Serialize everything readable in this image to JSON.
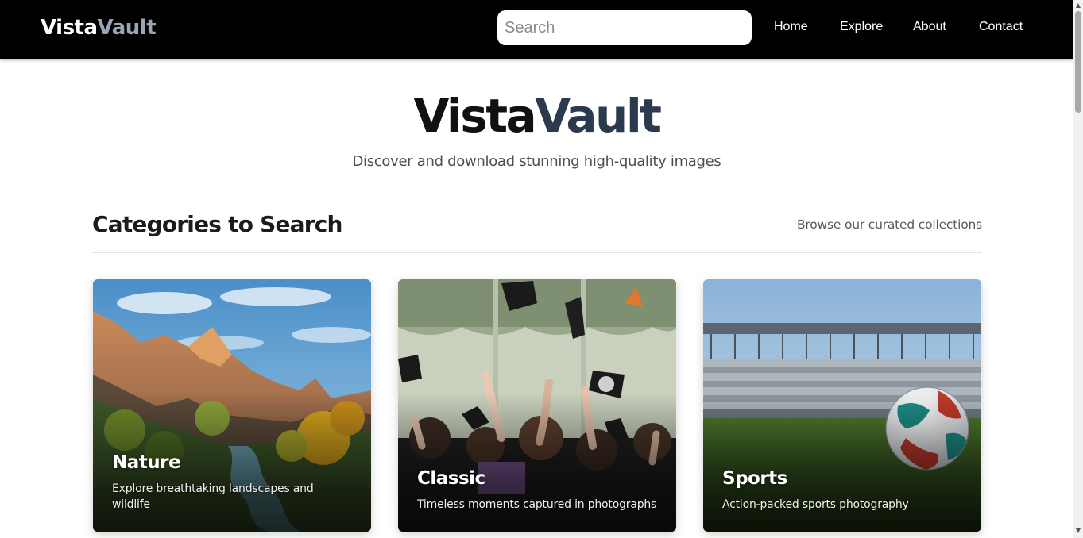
{
  "navbar": {
    "brand_part1": "Vista",
    "brand_part2": "Vault",
    "search_placeholder": "Search",
    "links": [
      "Home",
      "Explore",
      "About",
      "Contact"
    ]
  },
  "hero": {
    "title_part1": "Vista",
    "title_part2": "Vault",
    "subtitle": "Discover and download stunning high-quality images"
  },
  "categories_section": {
    "title": "Categories to Search",
    "subtitle": "Browse our curated collections",
    "cards": [
      {
        "title": "Nature",
        "description": "Explore breathtaking landscapes and wildlife",
        "image": "mountain-canyon-river"
      },
      {
        "title": "Classic",
        "description": "Timeless moments captured in photographs",
        "image": "graduation-caps-thrown"
      },
      {
        "title": "Sports",
        "description": "Action-packed sports photography",
        "image": "soccer-ball-stadium"
      }
    ]
  },
  "colors": {
    "navbar_bg": "#000000",
    "brand_accent": "#9aa6b8",
    "hero_accent": "#2c3a4d"
  }
}
